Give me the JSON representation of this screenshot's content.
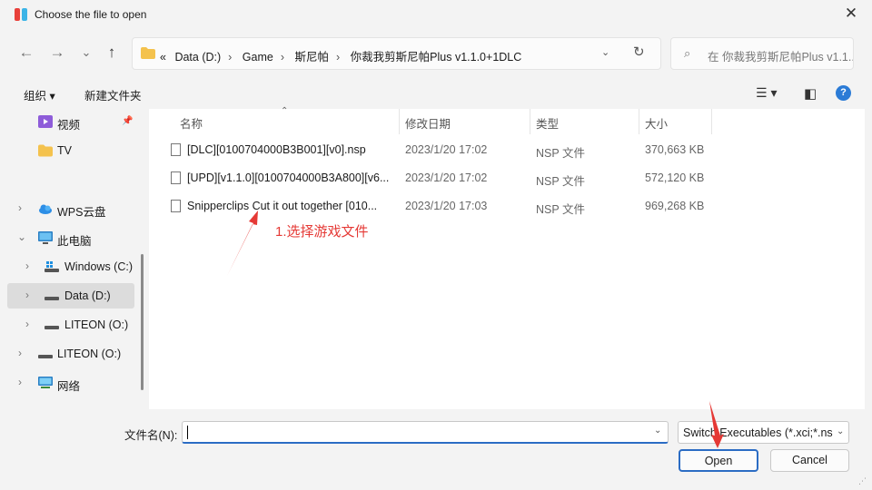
{
  "window": {
    "title": "Choose the file to open",
    "close_glyph": "✕",
    "icon": "switch-emulator-icon"
  },
  "nav": {
    "back_glyph": "←",
    "forward_glyph": "→",
    "recent_glyph": "⌄",
    "up_glyph": "↑"
  },
  "address": {
    "overflow": "«",
    "crumbs": [
      "Data (D:)",
      "Game",
      "斯尼帕",
      "你裁我剪斯尼帕Plus v1.1.0+1DLC"
    ],
    "separator": "›",
    "dropdown_glyph": "⌄",
    "refresh_glyph": "↻"
  },
  "search": {
    "icon": "⌕",
    "placeholder": "在 你裁我剪斯尼帕Plus v1.1..."
  },
  "toolbar": {
    "organize": "组织 ▾",
    "new_folder": "新建文件夹",
    "view_glyph": "☰ ▾",
    "pane_glyph": "◧",
    "help": "?"
  },
  "sidebar": {
    "items": [
      {
        "label": "视频",
        "icon": "video-icon",
        "pinned": true
      },
      {
        "label": "TV",
        "icon": "folder-icon"
      },
      {
        "label": "WPS云盘",
        "icon": "cloud-icon"
      },
      {
        "label": "此电脑",
        "icon": "computer-icon"
      },
      {
        "label": "Windows (C:)",
        "icon": "windows-drive-icon"
      },
      {
        "label": "Data (D:)",
        "icon": "drive-icon"
      },
      {
        "label": "LITEON (O:)",
        "icon": "drive-icon"
      },
      {
        "label": "LITEON (O:)",
        "icon": "drive-icon"
      },
      {
        "label": "网络",
        "icon": "network-icon"
      }
    ],
    "chevron_right": "›",
    "chevron_down": "⌄",
    "pin_glyph": "📌"
  },
  "files": {
    "columns": [
      "名称",
      "修改日期",
      "类型",
      "大小"
    ],
    "sort_glyph": "⌃",
    "rows": [
      {
        "name": "[DLC][0100704000B3B001][v0].nsp",
        "date": "2023/1/20 17:02",
        "type": "NSP 文件",
        "size": "370,663 KB"
      },
      {
        "name": "[UPD][v1.1.0][0100704000B3A800][v6...",
        "date": "2023/1/20 17:02",
        "type": "NSP 文件",
        "size": "572,120 KB"
      },
      {
        "name": "Snipperclips Cut it out together [010...",
        "date": "2023/1/20 17:03",
        "type": "NSP 文件",
        "size": "969,268 KB"
      }
    ]
  },
  "annotation": {
    "text": "1.选择游戏文件",
    "color": "#e53935"
  },
  "bottom": {
    "filename_label": "文件名(N):",
    "filename_value": "",
    "dropdown_glyph": "⌄",
    "filter_value": "Switch Executables (*.xci;*.ns",
    "open": "Open",
    "cancel": "Cancel"
  },
  "colors": {
    "accent": "#2b6cc4",
    "background": "#f3f3f3",
    "pane": "#ffffff"
  }
}
